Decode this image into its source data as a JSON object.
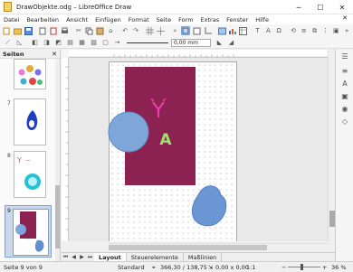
{
  "window": {
    "title": "DrawObjekte.odg – LibreOffice Draw",
    "minimize": "─",
    "maximize": "☐",
    "close": "✕"
  },
  "menu": {
    "items": [
      "Datei",
      "Bearbeiten",
      "Ansicht",
      "Einfügen",
      "Format",
      "Seite",
      "Form",
      "Extras",
      "Fenster",
      "Hilfe"
    ],
    "close_doc": "✕"
  },
  "toolbar": {
    "line_width": "0,00 mm"
  },
  "pages_panel": {
    "title": "Seiten",
    "close": "✕",
    "page_numbers": [
      "7",
      "8",
      "9"
    ]
  },
  "canvas": {
    "letter_shape_text": "A",
    "accent_color": "#8b2252",
    "ellipse_color": "#7ea6d8"
  },
  "tabs": {
    "items": [
      "Layout",
      "Steuerelemente",
      "Maßlinien"
    ],
    "active": "Layout"
  },
  "status": {
    "page": "Seite 9 von 9",
    "style": "Standard",
    "position": "366,30 / 138,75",
    "size": "0,00 x 0,00",
    "scale": "1:1",
    "zoom": "36 %"
  }
}
